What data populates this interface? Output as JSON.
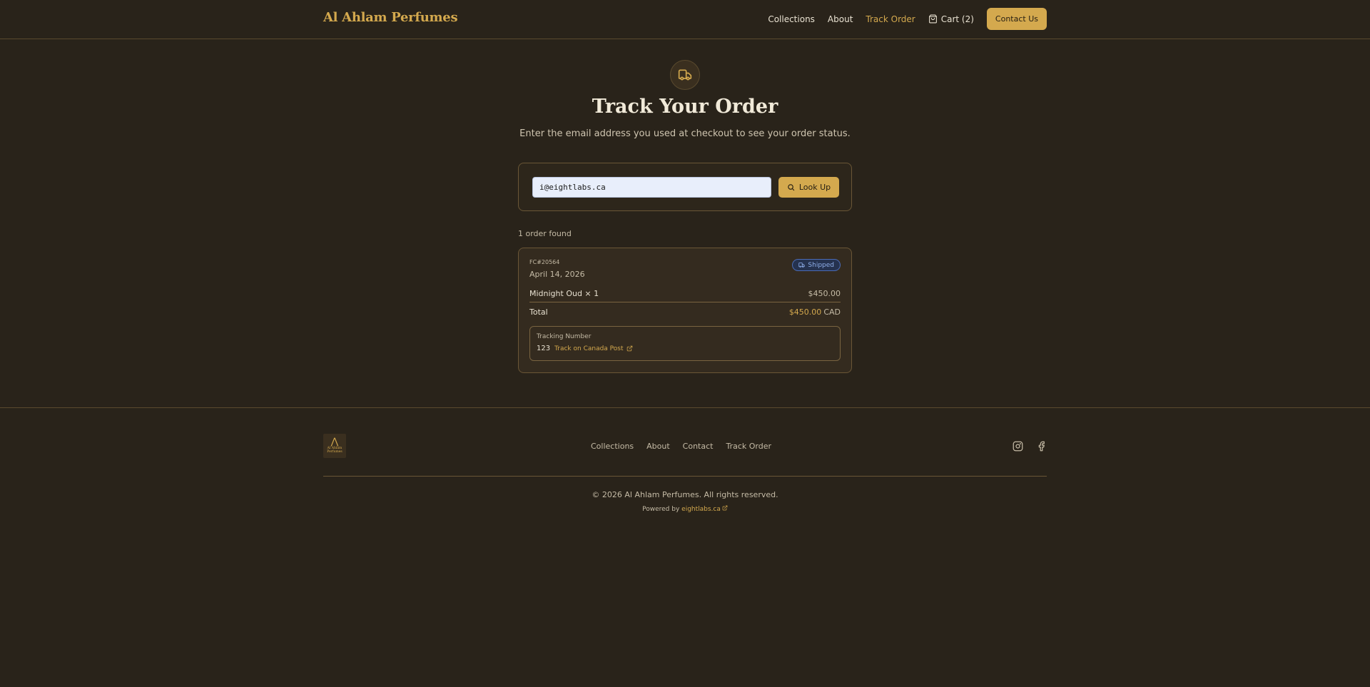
{
  "header": {
    "brand": "Al Ahlam Perfumes",
    "nav": {
      "collections": "Collections",
      "about": "About",
      "track_order": "Track Order",
      "cart": "Cart (2)",
      "contact": "Contact Us"
    }
  },
  "hero": {
    "title": "Track Your Order",
    "subtitle": "Enter the email address you used at checkout to see your order status."
  },
  "lookup": {
    "email_value": "i@eightlabs.ca",
    "button_label": "Look Up"
  },
  "results": {
    "count_text": "1 order found",
    "order": {
      "id": "FC#20564",
      "date": "April 14, 2026",
      "status": "Shipped",
      "item": "Midnight Oud × 1",
      "item_price": "$450.00",
      "total_label": "Total",
      "total_amount": "$450.00",
      "total_currency": "CAD",
      "tracking_label": "Tracking Number",
      "tracking_number": "123",
      "track_link": "Track on Canada Post"
    }
  },
  "footer": {
    "logo_text": "Al Ahlam Perfumes",
    "nav": {
      "collections": "Collections",
      "about": "About",
      "contact": "Contact",
      "track_order": "Track Order"
    },
    "copyright": "© 2026 Al Ahlam Perfumes. All rights reserved.",
    "powered_prefix": "Powered by",
    "powered_link": "eightlabs.ca"
  },
  "colors": {
    "background": "#29231a",
    "accent": "#d4a94e",
    "status_shipped": "#8eaee8"
  },
  "icons": [
    "truck-icon",
    "cart-icon",
    "search-icon",
    "external-link-icon",
    "instagram-icon",
    "facebook-icon"
  ]
}
